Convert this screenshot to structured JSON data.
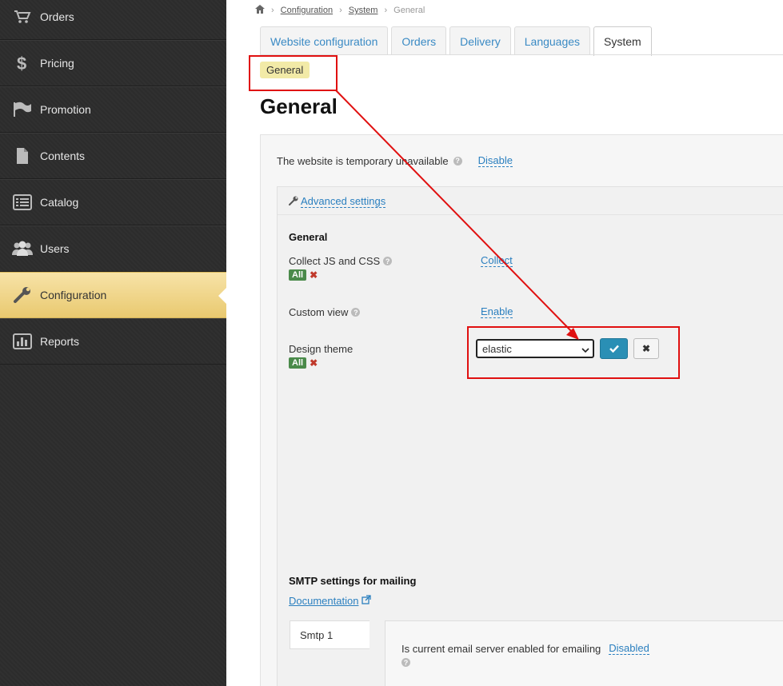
{
  "sidebar": {
    "items": [
      {
        "label": "Orders",
        "icon": "cart-icon"
      },
      {
        "label": "Pricing",
        "icon": "dollar-icon"
      },
      {
        "label": "Promotion",
        "icon": "flag-icon"
      },
      {
        "label": "Contents",
        "icon": "file-icon"
      },
      {
        "label": "Catalog",
        "icon": "list-icon"
      },
      {
        "label": "Users",
        "icon": "users-icon"
      },
      {
        "label": "Configuration",
        "icon": "wrench-icon",
        "active": true
      },
      {
        "label": "Reports",
        "icon": "bar-chart-icon"
      }
    ]
  },
  "breadcrumb": {
    "items": [
      "Configuration",
      "System",
      "General"
    ]
  },
  "tabs": [
    "Website configuration",
    "Orders",
    "Delivery",
    "Languages",
    "System"
  ],
  "active_tab": "System",
  "subsection_badge": "General",
  "page_title": "General",
  "website_unavailable": {
    "label": "The website is temporary unavailable",
    "action": "Disable"
  },
  "advanced_settings": {
    "link": "Advanced settings",
    "section_title": "General",
    "collect": {
      "label": "Collect JS and CSS",
      "scope": "All",
      "action": "Collect"
    },
    "custom_view": {
      "label": "Custom view",
      "action": "Enable"
    },
    "design_theme": {
      "label": "Design theme",
      "scope": "All",
      "selected": "elastic"
    }
  },
  "smtp": {
    "title": "SMTP settings for mailing",
    "doc_link": "Documentation",
    "tab": "Smtp 1",
    "enabled_label": "Is current email server enabled for emailing",
    "enabled_value": "Disabled"
  },
  "colors": {
    "annotation": "#e01010",
    "active_nav": "#f0d588",
    "link": "#2a7fbf",
    "confirm_button": "#2a8fb5"
  }
}
